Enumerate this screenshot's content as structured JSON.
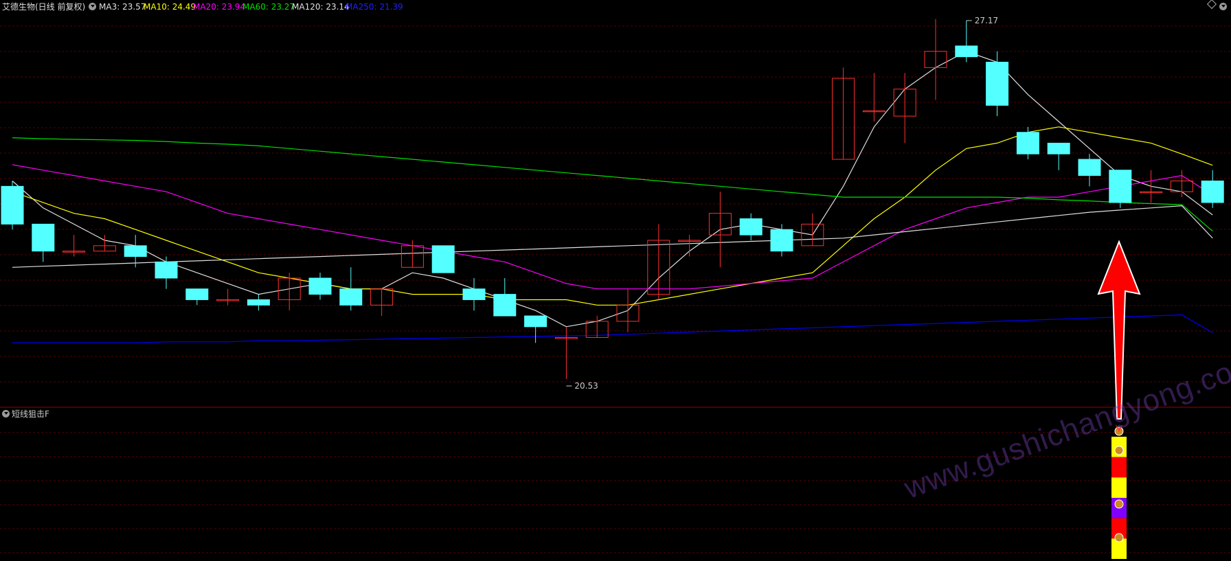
{
  "header": {
    "stock_title": "艾德生物(日线 前复权)",
    "indicators": [
      {
        "label": "MA3: 23.57",
        "color": "#e0e0e0"
      },
      {
        "label": "MA10: 24.49",
        "color": "#ffff00"
      },
      {
        "label": "MA20: 23.94",
        "color": "#ff00ff"
      },
      {
        "label": "MA60: 23.27",
        "color": "#00e000"
      },
      {
        "label": "MA120: 23.14",
        "color": "#e0e0e0"
      },
      {
        "label": "MA250: 21.39",
        "color": "#0000ff"
      }
    ]
  },
  "sub_panel": {
    "title": "短线狙击F"
  },
  "annotations": {
    "high_label": "27.17",
    "low_label": "20.53"
  },
  "watermark": "www.gushichangyong.com",
  "colors": {
    "up": "#ff3030",
    "down": "#54ffff",
    "grid": "#5a0000",
    "arrow": "#ff0000"
  },
  "chart_data": {
    "type": "candlestick",
    "price_range": [
      20.2,
      27.5
    ],
    "candles": [
      {
        "o": 24.1,
        "h": 24.2,
        "l": 23.3,
        "c": 23.4
      },
      {
        "o": 23.4,
        "h": 23.4,
        "l": 22.7,
        "c": 22.9
      },
      {
        "o": 22.9,
        "h": 23.2,
        "l": 22.8,
        "c": 22.9
      },
      {
        "o": 22.9,
        "h": 23.2,
        "l": 22.9,
        "c": 23.0
      },
      {
        "o": 23.0,
        "h": 23.2,
        "l": 22.6,
        "c": 22.8
      },
      {
        "o": 22.7,
        "h": 22.8,
        "l": 22.2,
        "c": 22.4
      },
      {
        "o": 22.2,
        "h": 22.2,
        "l": 21.9,
        "c": 22.0
      },
      {
        "o": 22.0,
        "h": 22.2,
        "l": 21.9,
        "c": 22.0
      },
      {
        "o": 22.0,
        "h": 22.1,
        "l": 21.8,
        "c": 21.9
      },
      {
        "o": 22.0,
        "h": 22.5,
        "l": 21.8,
        "c": 22.4
      },
      {
        "o": 22.4,
        "h": 22.5,
        "l": 22.0,
        "c": 22.1
      },
      {
        "o": 22.2,
        "h": 22.6,
        "l": 21.8,
        "c": 21.9
      },
      {
        "o": 21.9,
        "h": 22.2,
        "l": 21.7,
        "c": 22.2
      },
      {
        "o": 22.6,
        "h": 23.1,
        "l": 22.6,
        "c": 23.0
      },
      {
        "o": 23.0,
        "h": 23.0,
        "l": 22.5,
        "c": 22.5
      },
      {
        "o": 22.2,
        "h": 22.4,
        "l": 21.8,
        "c": 22.0
      },
      {
        "o": 22.1,
        "h": 22.4,
        "l": 21.8,
        "c": 21.7
      },
      {
        "o": 21.7,
        "h": 21.7,
        "l": 21.2,
        "c": 21.5
      },
      {
        "o": 21.3,
        "h": 21.5,
        "l": 20.53,
        "c": 21.3
      },
      {
        "o": 21.3,
        "h": 21.7,
        "l": 21.3,
        "c": 21.6
      },
      {
        "o": 21.6,
        "h": 22.2,
        "l": 21.4,
        "c": 21.9
      },
      {
        "o": 22.1,
        "h": 23.4,
        "l": 22.0,
        "c": 23.1
      },
      {
        "o": 23.1,
        "h": 23.2,
        "l": 22.8,
        "c": 23.1
      },
      {
        "o": 23.2,
        "h": 24.0,
        "l": 22.6,
        "c": 23.6
      },
      {
        "o": 23.5,
        "h": 23.6,
        "l": 23.1,
        "c": 23.2
      },
      {
        "o": 23.3,
        "h": 23.4,
        "l": 22.8,
        "c": 22.9
      },
      {
        "o": 23.0,
        "h": 23.6,
        "l": 23.0,
        "c": 23.4
      },
      {
        "o": 24.6,
        "h": 26.3,
        "l": 24.6,
        "c": 26.1
      },
      {
        "o": 25.5,
        "h": 26.2,
        "l": 25.3,
        "c": 25.5
      },
      {
        "o": 25.4,
        "h": 26.2,
        "l": 24.9,
        "c": 25.9
      },
      {
        "o": 26.3,
        "h": 27.2,
        "l": 25.7,
        "c": 26.6
      },
      {
        "o": 26.7,
        "h": 27.17,
        "l": 26.4,
        "c": 26.5
      },
      {
        "o": 26.4,
        "h": 26.6,
        "l": 25.4,
        "c": 25.6
      },
      {
        "o": 25.1,
        "h": 25.2,
        "l": 24.6,
        "c": 24.7
      },
      {
        "o": 24.9,
        "h": 24.9,
        "l": 24.4,
        "c": 24.7
      },
      {
        "o": 24.6,
        "h": 24.7,
        "l": 24.1,
        "c": 24.3
      },
      {
        "o": 24.4,
        "h": 24.4,
        "l": 23.7,
        "c": 23.8
      },
      {
        "o": 24.0,
        "h": 24.4,
        "l": 23.8,
        "c": 24.0
      },
      {
        "o": 24.0,
        "h": 24.4,
        "l": 23.9,
        "c": 24.2
      },
      {
        "o": 24.2,
        "h": 24.4,
        "l": 23.7,
        "c": 23.8
      }
    ],
    "lines": [
      {
        "name": "MA3",
        "color": "#e0e0e0",
        "values": [
          24.2,
          23.7,
          23.4,
          23.1,
          23.0,
          22.7,
          22.5,
          22.3,
          22.1,
          22.2,
          22.3,
          22.2,
          22.2,
          22.5,
          22.4,
          22.2,
          22.0,
          21.8,
          21.5,
          21.6,
          21.8,
          22.4,
          22.9,
          23.3,
          23.4,
          23.3,
          23.2,
          24.1,
          25.2,
          25.9,
          26.3,
          26.6,
          26.4,
          25.8,
          25.3,
          24.8,
          24.3,
          24.1,
          24.0,
          23.57
        ]
      },
      {
        "name": "MA10",
        "color": "#ffff00",
        "values": [
          24.0,
          23.8,
          23.6,
          23.5,
          23.3,
          23.1,
          22.9,
          22.7,
          22.5,
          22.4,
          22.3,
          22.2,
          22.2,
          22.1,
          22.1,
          22.1,
          22.0,
          22.0,
          22.0,
          21.9,
          21.9,
          22.0,
          22.1,
          22.2,
          22.3,
          22.4,
          22.5,
          23.0,
          23.5,
          23.9,
          24.4,
          24.8,
          24.9,
          25.1,
          25.2,
          25.1,
          25.0,
          24.9,
          24.7,
          24.49
        ]
      },
      {
        "name": "MA20",
        "color": "#ff00ff",
        "values": [
          24.5,
          24.4,
          24.3,
          24.2,
          24.1,
          24.0,
          23.8,
          23.6,
          23.5,
          23.4,
          23.3,
          23.2,
          23.1,
          23.0,
          22.9,
          22.8,
          22.7,
          22.5,
          22.3,
          22.2,
          22.2,
          22.2,
          22.2,
          22.25,
          22.3,
          22.35,
          22.4,
          22.7,
          23.0,
          23.3,
          23.5,
          23.7,
          23.8,
          23.9,
          23.9,
          24.0,
          24.1,
          24.2,
          24.3,
          23.94
        ]
      },
      {
        "name": "MA60",
        "color": "#00e000",
        "values": [
          25.0,
          24.98,
          24.97,
          24.96,
          24.95,
          24.93,
          24.9,
          24.88,
          24.85,
          24.8,
          24.75,
          24.7,
          24.65,
          24.6,
          24.55,
          24.5,
          24.45,
          24.4,
          24.35,
          24.3,
          24.25,
          24.2,
          24.15,
          24.1,
          24.05,
          24.0,
          23.95,
          23.9,
          23.9,
          23.9,
          23.9,
          23.9,
          23.9,
          23.88,
          23.85,
          23.83,
          23.8,
          23.78,
          23.76,
          23.27
        ]
      },
      {
        "name": "MA120",
        "color": "#e0e0e0",
        "values": [
          22.6,
          22.62,
          22.64,
          22.66,
          22.68,
          22.7,
          22.72,
          22.74,
          22.76,
          22.78,
          22.8,
          22.82,
          22.84,
          22.86,
          22.88,
          22.9,
          22.92,
          22.94,
          22.96,
          22.98,
          23.0,
          23.02,
          23.04,
          23.06,
          23.08,
          23.1,
          23.12,
          23.14,
          23.2,
          23.26,
          23.32,
          23.38,
          23.44,
          23.5,
          23.56,
          23.62,
          23.66,
          23.7,
          23.74,
          23.14
        ]
      },
      {
        "name": "MA250",
        "color": "#0000ff",
        "values": [
          21.2,
          21.2,
          21.2,
          21.2,
          21.2,
          21.22,
          21.22,
          21.22,
          21.24,
          21.24,
          21.25,
          21.26,
          21.27,
          21.28,
          21.29,
          21.3,
          21.31,
          21.32,
          21.33,
          21.34,
          21.36,
          21.38,
          21.4,
          21.42,
          21.44,
          21.46,
          21.48,
          21.5,
          21.52,
          21.54,
          21.56,
          21.58,
          21.6,
          21.62,
          21.64,
          21.66,
          21.68,
          21.7,
          21.72,
          21.39
        ]
      }
    ],
    "signal_blocks": [
      "#ffff00",
      "#ff0000",
      "#ffff00",
      "#8000ff",
      "#ff0000",
      "#ffff00"
    ]
  }
}
